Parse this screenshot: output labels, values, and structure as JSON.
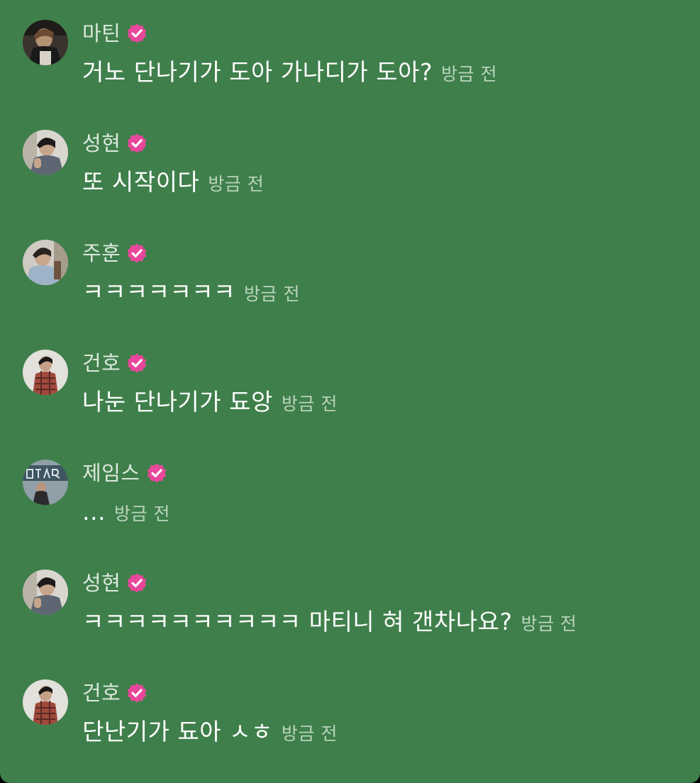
{
  "colors": {
    "background": "#3f7f4b",
    "name": "#dce9de",
    "message": "#ffffff",
    "timestamp": "#b9d4bd",
    "verified_badge": "#e8479b"
  },
  "messages": [
    {
      "name": "마틴",
      "verified": true,
      "text": "거노 단나기가 도아 가나디가 도아?",
      "time": "방금 전"
    },
    {
      "name": "성현",
      "verified": true,
      "text": "또 시작이다",
      "time": "방금 전"
    },
    {
      "name": "주훈",
      "verified": true,
      "text": "ㅋㅋㅋㅋㅋㅋㅋ",
      "time": "방금 전"
    },
    {
      "name": "건호",
      "verified": true,
      "text": "나눈 단나기가 됴앙",
      "time": "방금 전"
    },
    {
      "name": "제임스",
      "verified": true,
      "text": "...",
      "time": "방금 전"
    },
    {
      "name": "성현",
      "verified": true,
      "text": "ㅋㅋㅋㅋㅋㅋㅋㅋㅋㅋ 마티니 혀 갠차나요?",
      "time": "방금 전"
    },
    {
      "name": "건호",
      "verified": true,
      "text": "단난기가 됴아 ㅅㅎ",
      "time": "방금 전"
    }
  ]
}
